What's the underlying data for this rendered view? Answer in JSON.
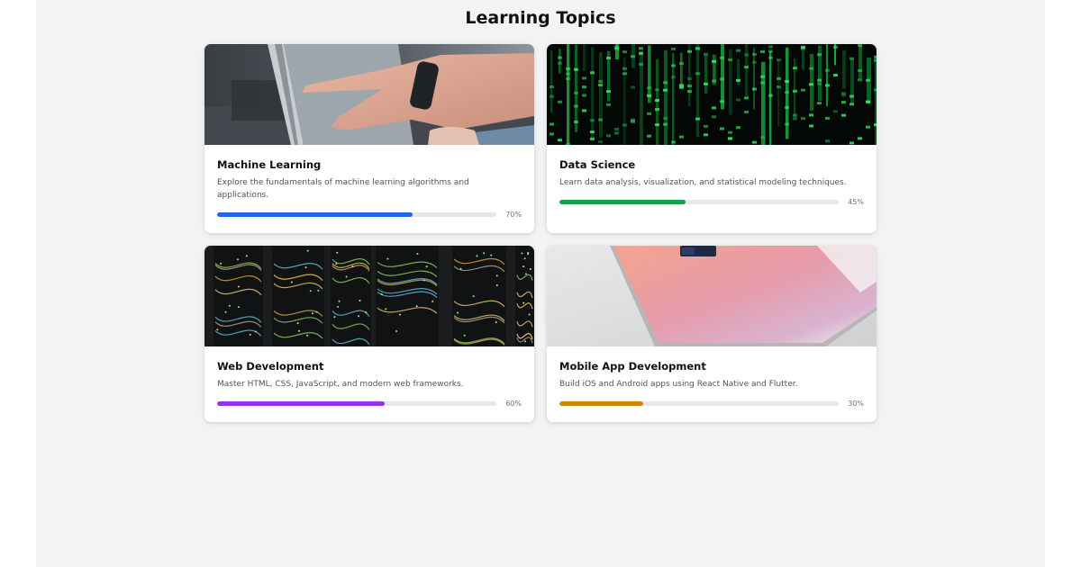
{
  "page": {
    "title": "Learning Topics"
  },
  "topics": [
    {
      "title": "Machine Learning",
      "description": "Explore the fundamentals of machine learning algorithms and applications.",
      "progress": 70,
      "progress_label": "70%",
      "color": "#2563eb",
      "image": "laptop-touchscreen-photo"
    },
    {
      "title": "Data Science",
      "description": "Learn data analysis, visualization, and statistical modeling techniques.",
      "progress": 45,
      "progress_label": "45%",
      "color": "#16a34a",
      "image": "green-code-matrix-photo"
    },
    {
      "title": "Web Development",
      "description": "Master HTML, CSS, JavaScript, and modern web frameworks.",
      "progress": 60,
      "progress_label": "60%",
      "color": "#9333ea",
      "image": "server-rack-cables-photo"
    },
    {
      "title": "Mobile App Development",
      "description": "Build iOS and Android apps using React Native and Flutter.",
      "progress": 30,
      "progress_label": "30%",
      "color": "#ca8a04",
      "image": "pink-laptop-photo"
    }
  ]
}
